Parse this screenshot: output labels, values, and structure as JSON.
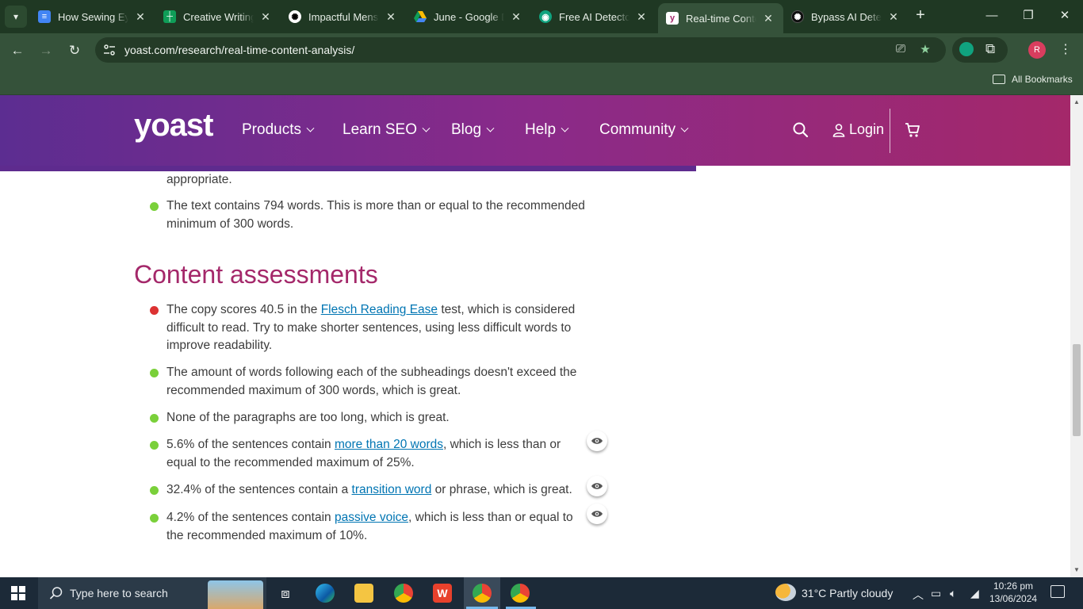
{
  "browser": {
    "tabs": [
      {
        "title": "How Sewing Eye",
        "icon": "google-docs-icon",
        "color": "#4285f4"
      },
      {
        "title": "Creative Writing",
        "icon": "google-sheets-icon",
        "color": "#0f9d58"
      },
      {
        "title": "Impactful Menst",
        "icon": "openai-icon",
        "color": "#ffffff"
      },
      {
        "title": "June - Google D",
        "icon": "google-drive-icon",
        "color": "#fbbc04"
      },
      {
        "title": "Free AI Detector",
        "icon": "ai-detector-icon",
        "color": "#10a37f"
      },
      {
        "title": "Real-time Conte",
        "icon": "yoast-icon",
        "color": "#a4286a"
      },
      {
        "title": "Bypass AI Detect",
        "icon": "openai-icon",
        "color": "#000000"
      }
    ],
    "active_tab": 5,
    "url": "yoast.com/research/real-time-content-analysis/",
    "bookmarks_label": "All Bookmarks",
    "profile_initial": "R"
  },
  "site": {
    "logo": "yoast",
    "menu": [
      "Products",
      "Learn SEO",
      "Blog",
      "Help",
      "Community"
    ],
    "login_label": "Login"
  },
  "article": {
    "fragment": "appropriate.",
    "word_count_item": "The text contains 794 words. This is more than or equal to the recommended minimum of 300 words.",
    "heading": "Content assessments",
    "assessments": [
      {
        "status": "red",
        "before": "The copy scores 40.5 in the ",
        "link": "Flesch Reading Ease",
        "after": " test, which is considered difficult to read. Try to make shorter sentences, using less difficult words to improve readability.",
        "eye": false
      },
      {
        "status": "green",
        "before": "The amount of words following each of the subheadings doesn't exceed the recommended maximum of 300 words, which is great.",
        "link": "",
        "after": "",
        "eye": false
      },
      {
        "status": "green",
        "before": "None of the paragraphs are too long, which is great.",
        "link": "",
        "after": "",
        "eye": false
      },
      {
        "status": "green",
        "before": "5.6% of the sentences contain ",
        "link": "more than 20 words",
        "after": ", which is less than or equal to the recommended maximum of 25%.",
        "eye": true
      },
      {
        "status": "green",
        "before": "32.4% of the sentences contain a ",
        "link": "transition word",
        "after": " or phrase, which is great.",
        "eye": true
      },
      {
        "status": "green",
        "before": "4.2% of the sentences contain ",
        "link": "passive voice",
        "after": ", which is less than or equal to the recommended maximum of 10%.",
        "eye": true
      }
    ]
  },
  "taskbar": {
    "search_placeholder": "Type here to search",
    "weather": "31°C  Partly cloudy",
    "time": "10:26 pm",
    "date": "13/06/2024"
  },
  "colors": {
    "status_green": "#7ad03a",
    "status_red": "#dc3232",
    "link": "#0075b3",
    "heading": "#a4286a"
  }
}
